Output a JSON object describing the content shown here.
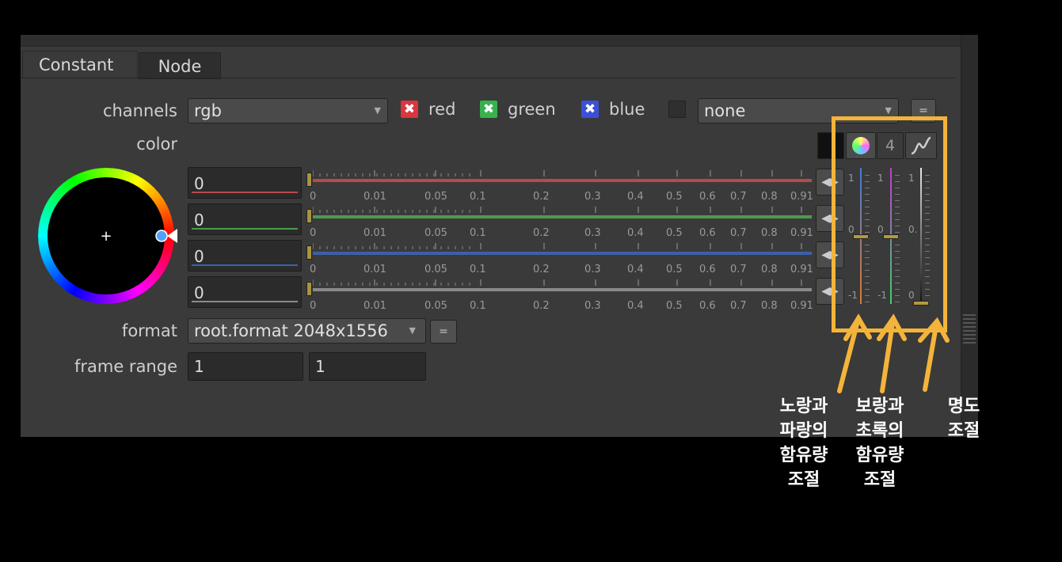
{
  "tabs": [
    {
      "label": "Constant"
    },
    {
      "label": "Node"
    }
  ],
  "channels": {
    "label": "channels",
    "value": "rgb",
    "checks": [
      {
        "label": "red",
        "color": "#d9363e"
      },
      {
        "label": "green",
        "color": "#37b24d"
      },
      {
        "label": "blue",
        "color": "#3b50d6"
      }
    ],
    "extra_value": "none",
    "extra_button": "="
  },
  "color": {
    "label": "color",
    "tool_count": "4",
    "sliders": [
      {
        "value": "0",
        "color": "#b84a4a"
      },
      {
        "value": "0",
        "color": "#4c9a4c"
      },
      {
        "value": "0",
        "color": "#3e5fa8"
      },
      {
        "value": "0",
        "color": "#8a8a8a"
      }
    ],
    "tick_labels": [
      "0",
      "0.01",
      "0.05",
      "0.1",
      "0.2",
      "0.3",
      "0.4",
      "0.5",
      "0.6",
      "0.7",
      "0.8",
      "0.91"
    ]
  },
  "format": {
    "label": "format",
    "value": "root.format 2048x1556",
    "button": "="
  },
  "frame_range": {
    "label": "frame range",
    "start": "1",
    "end": "1"
  },
  "mini_sliders": {
    "first_labels": [
      "1",
      "0",
      "-1"
    ],
    "second_labels": [
      "1",
      "0",
      "-1"
    ],
    "third_labels": [
      "1",
      "0.",
      "0"
    ]
  },
  "annotations": [
    {
      "text": "노랑과\n파랑의\n함유량\n조절"
    },
    {
      "text": "보랑과\n초록의\n함유량\n조절"
    },
    {
      "text": "명도\n조절"
    }
  ],
  "colors": {
    "highlight": "#f4b43a",
    "panel": "#3a3a3a"
  }
}
